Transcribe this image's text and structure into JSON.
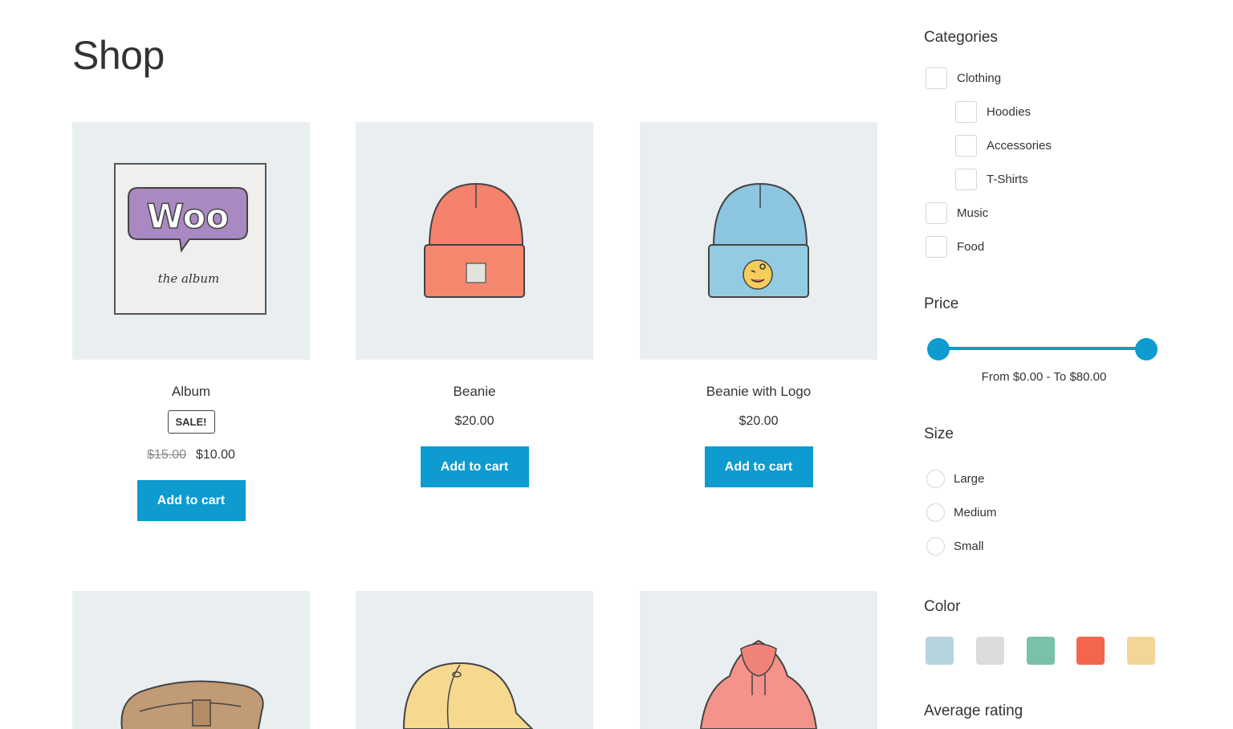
{
  "page": {
    "title": "Shop"
  },
  "products": [
    {
      "name": "Album",
      "sale_badge": "SALE!",
      "old_price": "$15.00",
      "price": "$10.00",
      "button": "Add to cart",
      "image": "album-image",
      "art_line1": "Woo",
      "art_line2": "the album"
    },
    {
      "name": "Beanie",
      "price": "$20.00",
      "button": "Add to cart",
      "image": "beanie-image"
    },
    {
      "name": "Beanie with Logo",
      "price": "$20.00",
      "button": "Add to cart",
      "image": "beanie-logo-image"
    },
    {
      "image": "belt-image"
    },
    {
      "image": "cap-image"
    },
    {
      "image": "hoodie-image"
    }
  ],
  "sidebar": {
    "categories": {
      "title": "Categories",
      "items": [
        {
          "label": "Clothing",
          "checked": false,
          "level": 0
        },
        {
          "label": "Hoodies",
          "checked": false,
          "level": 1
        },
        {
          "label": "Accessories",
          "checked": false,
          "level": 1
        },
        {
          "label": "T-Shirts",
          "checked": false,
          "level": 1
        },
        {
          "label": "Music",
          "checked": false,
          "level": 0
        },
        {
          "label": "Food",
          "checked": false,
          "level": 0
        }
      ]
    },
    "price": {
      "title": "Price",
      "range_text": "From $0.00 - To $80.00",
      "min": 0,
      "max": 80
    },
    "size": {
      "title": "Size",
      "options": [
        {
          "label": "Large",
          "selected": false
        },
        {
          "label": "Medium",
          "selected": false
        },
        {
          "label": "Small",
          "selected": false
        }
      ]
    },
    "color": {
      "title": "Color",
      "swatches": [
        "#b4d5df",
        "#dcdcdc",
        "#79c2a7",
        "#f3664d",
        "#f3d598"
      ]
    },
    "rating": {
      "title": "Average rating"
    }
  },
  "colors": {
    "accent": "#0d9bd0",
    "thumb_bg": "#e9eff1"
  }
}
